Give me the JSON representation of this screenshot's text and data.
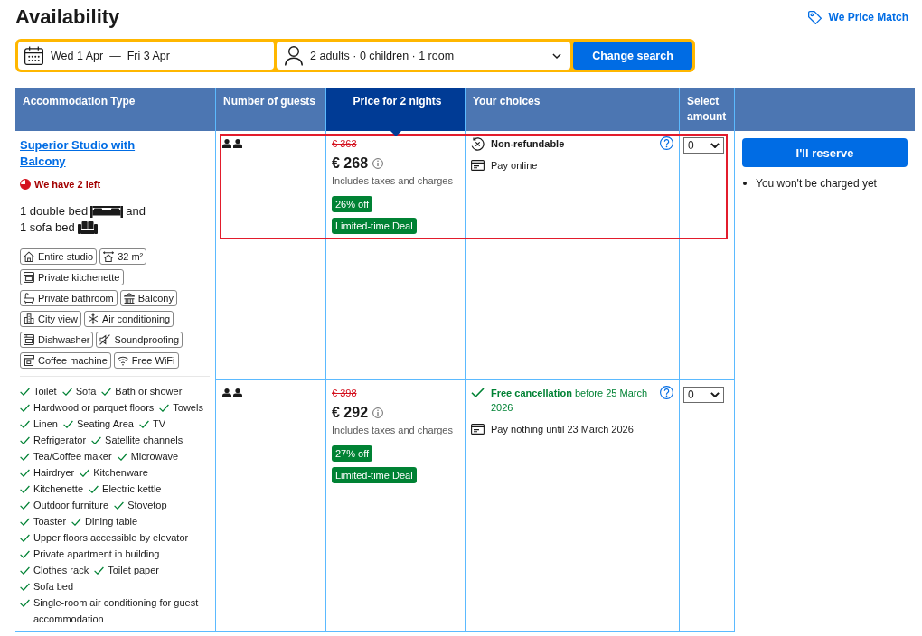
{
  "page": {
    "title": "Availability",
    "price_match_link": "We Price Match"
  },
  "search": {
    "check_in": "Wed 1 Apr",
    "date_separator": "—",
    "check_out": "Fri 3 Apr",
    "guests": "2 adults · 0 children · 1 room",
    "button": "Change search"
  },
  "table": {
    "columns": [
      {
        "label": "Accommodation Type",
        "highlighted": false
      },
      {
        "label": "Number of guests",
        "highlighted": false
      },
      {
        "label": "Price for 2 nights",
        "highlighted": true
      },
      {
        "label": "Your choices",
        "highlighted": false
      },
      {
        "label": "Select amount",
        "highlighted": false
      }
    ],
    "room": {
      "name": "Superior Studio with Balcony",
      "availability": "We have 2 left",
      "beds": [
        {
          "kind": "double",
          "label": "1 double bed",
          "joiner": "and"
        },
        {
          "kind": "sofa",
          "label": "1 sofa bed"
        }
      ],
      "facility_rows": [
        [
          {
            "kind": "house",
            "label": "Entire studio"
          },
          {
            "kind": "area",
            "label": "32 m²"
          }
        ],
        [
          {
            "kind": "oven",
            "label": "Private kitchenette"
          }
        ],
        [
          {
            "kind": "bath",
            "label": "Private bathroom"
          },
          {
            "kind": "balcony",
            "label": "Balcony"
          }
        ],
        [
          {
            "kind": "city",
            "label": "City view"
          },
          {
            "kind": "snowflake",
            "label": "Air conditioning"
          }
        ],
        [
          {
            "kind": "dishwasher",
            "label": "Dishwasher"
          },
          {
            "kind": "soundproof",
            "label": "Soundproofing"
          }
        ],
        [
          {
            "kind": "coffee",
            "label": "Coffee machine"
          },
          {
            "kind": "wifi",
            "label": "Free WiFi"
          }
        ]
      ],
      "amenity_lines": [
        [
          "Toilet",
          "Sofa",
          "Bath or shower"
        ],
        [
          "Hardwood or parquet floors",
          "Towels"
        ],
        [
          "Linen",
          "Seating Area",
          "TV"
        ],
        [
          "Refrigerator",
          "Satellite channels"
        ],
        [
          "Tea/Coffee maker",
          "Microwave"
        ],
        [
          "Hairdryer",
          "Kitchenware"
        ],
        [
          "Kitchenette",
          "Electric kettle"
        ],
        [
          "Outdoor furniture",
          "Stovetop"
        ],
        [
          "Toaster",
          "Dining table"
        ],
        [
          "Upper floors accessible by elevator"
        ],
        [
          "Private apartment in building"
        ],
        [
          "Clothes rack",
          "Toilet paper"
        ],
        [
          "Sofa bed"
        ],
        [
          "Single-room air conditioning for guest accommodation"
        ]
      ]
    },
    "rates": [
      {
        "highlighted": true,
        "original_price": "€ 363",
        "price": "€ 268",
        "price_note": "Includes taxes and charges",
        "badges": [
          "26% off",
          "Limited-time Deal"
        ],
        "policies": [
          {
            "kind": "non_refundable",
            "text": "Non-refundable"
          },
          {
            "kind": "payment",
            "text": "Pay online"
          }
        ],
        "amount": "0"
      },
      {
        "highlighted": false,
        "original_price": "€ 398",
        "price": "€ 292",
        "price_note": "Includes taxes and charges",
        "badges": [
          "27% off",
          "Limited-time Deal"
        ],
        "policies": [
          {
            "kind": "free_cancellation",
            "text": "**Free cancellation** before 25 March 2026"
          },
          {
            "kind": "payment",
            "text": "Pay nothing until 23 March 2026"
          }
        ],
        "amount": "0"
      }
    ],
    "reserve": {
      "button": "I'll reserve",
      "notes": [
        "You won't be charged yet"
      ]
    }
  }
}
